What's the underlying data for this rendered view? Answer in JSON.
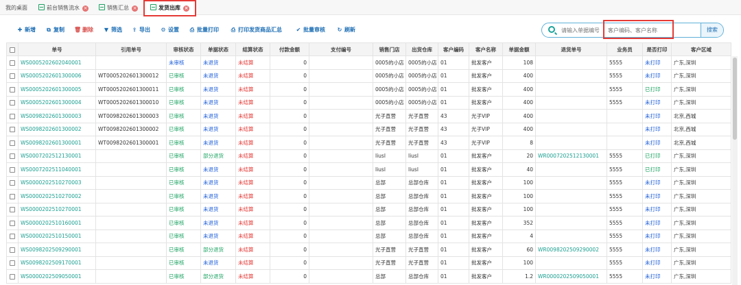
{
  "tabs": [
    {
      "label": "我的桌面"
    },
    {
      "label": "前台销售流水"
    },
    {
      "label": "销售汇总"
    },
    {
      "label": "发货出库"
    }
  ],
  "toolbar": {
    "add": "新增",
    "copy": "复制",
    "delete": "删除",
    "filter": "筛选",
    "export": "导出",
    "settings": "设置",
    "batch_print": "批量打印",
    "print_summary": "打印发货商品汇总",
    "batch_review": "批量审核",
    "refresh": "刷新"
  },
  "search": {
    "placeholder1": "请输入单据编号",
    "placeholder2": "客户编码、客户名称",
    "button": "搜索"
  },
  "columns": [
    "单号",
    "引用单号",
    "审核状态",
    "单据状态",
    "结算状态",
    "付款金额",
    "支付编号",
    "销售门店",
    "出货仓库",
    "客户编码",
    "客户名称",
    "单据金额",
    "退货单号",
    "业务员",
    "是否打印",
    "客户区域"
  ],
  "rows": [
    [
      "WS0005202602040001",
      "",
      "未审核",
      "未退货",
      "未结算",
      "0",
      "",
      "0005的小店",
      "0005的小店",
      "01",
      "批发客户",
      "108",
      "",
      "5555",
      "未打印",
      "广东,深圳"
    ],
    [
      "WS0005202601300006",
      "WT0005202601300012",
      "已审核",
      "未退货",
      "未结算",
      "0",
      "",
      "0005的小店",
      "0005的小店",
      "01",
      "批发客户",
      "400",
      "",
      "5555",
      "未打印",
      "广东,深圳"
    ],
    [
      "WS0005202601300005",
      "WT0005202601300011",
      "已审核",
      "未退货",
      "未结算",
      "0",
      "",
      "0005的小店",
      "0005的小店",
      "01",
      "批发客户",
      "400",
      "",
      "5555",
      "已打印",
      "广东,深圳"
    ],
    [
      "WS0005202601300004",
      "WT0005202601300010",
      "已审核",
      "未退货",
      "未结算",
      "0",
      "",
      "0005的小店",
      "0005的小店",
      "01",
      "批发客户",
      "400",
      "",
      "5555",
      "未打印",
      "广东,深圳"
    ],
    [
      "WS0098202601300003",
      "WT0098202601300003",
      "已审核",
      "未退货",
      "未结算",
      "0",
      "",
      "光子直营",
      "光子直营",
      "43",
      "光子VIP",
      "400",
      "",
      "",
      "未打印",
      "北京,西城"
    ],
    [
      "WS0098202601300002",
      "WT0098202601300002",
      "已审核",
      "未退货",
      "未结算",
      "0",
      "",
      "光子直营",
      "光子直营",
      "43",
      "光子VIP",
      "400",
      "",
      "",
      "未打印",
      "北京,西城"
    ],
    [
      "WS0098202601300001",
      "WT0098202601300001",
      "已审核",
      "未退货",
      "未结算",
      "0",
      "",
      "光子直营",
      "光子直营",
      "43",
      "光子VIP",
      "8",
      "",
      "",
      "未打印",
      "北京,西城"
    ],
    [
      "WS0007202512130001",
      "",
      "已审核",
      "部分退货",
      "未结算",
      "0",
      "",
      "liusl",
      "liusl",
      "01",
      "批发客户",
      "20",
      "WR0007202512130001",
      "5555",
      "已打印",
      "广东,深圳"
    ],
    [
      "WS0007202511040001",
      "",
      "已审核",
      "未退货",
      "未结算",
      "0",
      "",
      "liusl",
      "liusl",
      "01",
      "批发客户",
      "40",
      "",
      "5555",
      "已打印",
      "广东,深圳"
    ],
    [
      "WS0000202510270003",
      "",
      "已审核",
      "未退货",
      "未结算",
      "0",
      "",
      "总部",
      "总部仓库",
      "01",
      "批发客户",
      "100",
      "",
      "5555",
      "未打印",
      "广东,深圳"
    ],
    [
      "WS0000202510270002",
      "",
      "已审核",
      "未退货",
      "未结算",
      "0",
      "",
      "总部",
      "总部仓库",
      "01",
      "批发客户",
      "100",
      "",
      "5555",
      "未打印",
      "广东,深圳"
    ],
    [
      "WS0000202510270001",
      "",
      "已审核",
      "未退货",
      "未结算",
      "0",
      "",
      "总部",
      "总部仓库",
      "01",
      "批发客户",
      "100",
      "",
      "5555",
      "未打印",
      "广东,深圳"
    ],
    [
      "WS0000202510160001",
      "",
      "已审核",
      "未退货",
      "未结算",
      "0",
      "",
      "总部",
      "总部仓库",
      "01",
      "批发客户",
      "352",
      "",
      "5555",
      "未打印",
      "广东,深圳"
    ],
    [
      "WS0000202510150001",
      "",
      "已审核",
      "未退货",
      "未结算",
      "0",
      "",
      "总部",
      "总部仓库",
      "01",
      "批发客户",
      "4",
      "",
      "5555",
      "未打印",
      "广东,深圳"
    ],
    [
      "WS0098202509290001",
      "",
      "已审核",
      "部分退货",
      "未结算",
      "0",
      "",
      "光子直营",
      "光子直营",
      "01",
      "批发客户",
      "60",
      "WR0098202509290002",
      "5555",
      "未打印",
      "广东,深圳"
    ],
    [
      "WS0098202509170001",
      "",
      "已审核",
      "未退货",
      "未结算",
      "0",
      "",
      "光子直营",
      "光子直营",
      "01",
      "批发客户",
      "100",
      "",
      "5555",
      "未打印",
      "广东,深圳"
    ],
    [
      "WS0000202509050001",
      "",
      "已审核",
      "部分退货",
      "未结算",
      "0",
      "",
      "总部",
      "总部仓库",
      "01",
      "批发客户",
      "1.2",
      "WR0000202509050001",
      "5555",
      "未打印",
      "广东,深圳"
    ]
  ],
  "colors": {
    "green": "#1aa260",
    "blue": "#1a5bd8",
    "red": "#e53935",
    "teal": "#1a9e8f"
  }
}
